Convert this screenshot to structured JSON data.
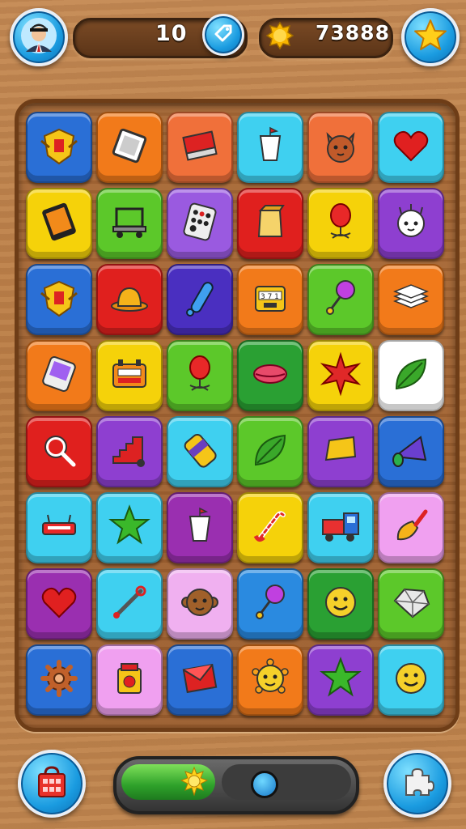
{
  "hud": {
    "moves": "10",
    "coins": "73888",
    "avatar_icon": "player-avatar-icon",
    "moves_icon": "tag-icon",
    "coin_icon": "gold-coin-icon",
    "star_icon": "star-icon"
  },
  "board": {
    "rows": 8,
    "cols": 6,
    "tiles": [
      {
        "color": "#2a6fd6",
        "icon": "emblem-icon"
      },
      {
        "color": "#f27a1a",
        "icon": "frame-icon"
      },
      {
        "color": "#f0703a",
        "icon": "book-icon"
      },
      {
        "color": "#3fd0f0",
        "icon": "cup-icon"
      },
      {
        "color": "#f0703a",
        "icon": "cat-face-icon"
      },
      {
        "color": "#3fd0f0",
        "icon": "heart-icon"
      },
      {
        "color": "#f5d20a",
        "icon": "tablet-icon"
      },
      {
        "color": "#5cc82a",
        "icon": "cart-icon"
      },
      {
        "color": "#9a5ae0",
        "icon": "phone-icon"
      },
      {
        "color": "#e0201e",
        "icon": "box-icon"
      },
      {
        "color": "#f5d20a",
        "icon": "balloon-icon"
      },
      {
        "color": "#8e3fd0",
        "icon": "creature-icon"
      },
      {
        "color": "#2a6fd6",
        "icon": "emblem-icon"
      },
      {
        "color": "#e0201e",
        "icon": "hat-icon"
      },
      {
        "color": "#4a2fc0",
        "icon": "bat-icon"
      },
      {
        "color": "#f27a1a",
        "icon": "machine-icon"
      },
      {
        "color": "#5cc82a",
        "icon": "lollipop-icon"
      },
      {
        "color": "#f27a1a",
        "icon": "papers-icon"
      },
      {
        "color": "#f27a1a",
        "icon": "device-icon"
      },
      {
        "color": "#f5d20a",
        "icon": "radio-icon"
      },
      {
        "color": "#5cc82a",
        "icon": "balloon-icon"
      },
      {
        "color": "#2aa033",
        "icon": "lips-icon"
      },
      {
        "color": "#f5d20a",
        "icon": "burst-icon"
      },
      {
        "color": "#ffffff",
        "icon": "leaf-icon"
      },
      {
        "color": "#e0201e",
        "icon": "magnifier-icon"
      },
      {
        "color": "#8e3fd0",
        "icon": "stairs-icon"
      },
      {
        "color": "#3fd0f0",
        "icon": "can-icon"
      },
      {
        "color": "#5cc82a",
        "icon": "leaf-icon"
      },
      {
        "color": "#8e3fd0",
        "icon": "cheese-icon"
      },
      {
        "color": "#2a6fd6",
        "icon": "cone-icon"
      },
      {
        "color": "#3fd0f0",
        "icon": "router-icon"
      },
      {
        "color": "#3fd0f0",
        "icon": "star-icon"
      },
      {
        "color": "#9a2fb0",
        "icon": "cup-icon"
      },
      {
        "color": "#f5d20a",
        "icon": "cane-icon"
      },
      {
        "color": "#3fd0f0",
        "icon": "truck-icon"
      },
      {
        "color": "#f0a0f0",
        "icon": "brush-icon"
      },
      {
        "color": "#9a2fb0",
        "icon": "heart-icon"
      },
      {
        "color": "#3fd0f0",
        "icon": "wrench-icon"
      },
      {
        "color": "#f0b0f0",
        "icon": "monkey-face-icon"
      },
      {
        "color": "#2a8ae0",
        "icon": "lollipop-icon"
      },
      {
        "color": "#2aa033",
        "icon": "smiley-icon"
      },
      {
        "color": "#5cc82a",
        "icon": "gem-icon"
      },
      {
        "color": "#2a6fd6",
        "icon": "gear-icon"
      },
      {
        "color": "#f0a0f0",
        "icon": "jar-icon"
      },
      {
        "color": "#2a6fd6",
        "icon": "envelope-icon"
      },
      {
        "color": "#f27a1a",
        "icon": "sun-face-icon"
      },
      {
        "color": "#8e3fd0",
        "icon": "star-icon"
      },
      {
        "color": "#3fd0f0",
        "icon": "smiley-icon"
      }
    ]
  },
  "footer": {
    "shop_icon": "shop-icon",
    "puzzle_icon": "puzzle-piece-icon",
    "progress_icon": "sun-icon",
    "progress_level": 0.42
  }
}
